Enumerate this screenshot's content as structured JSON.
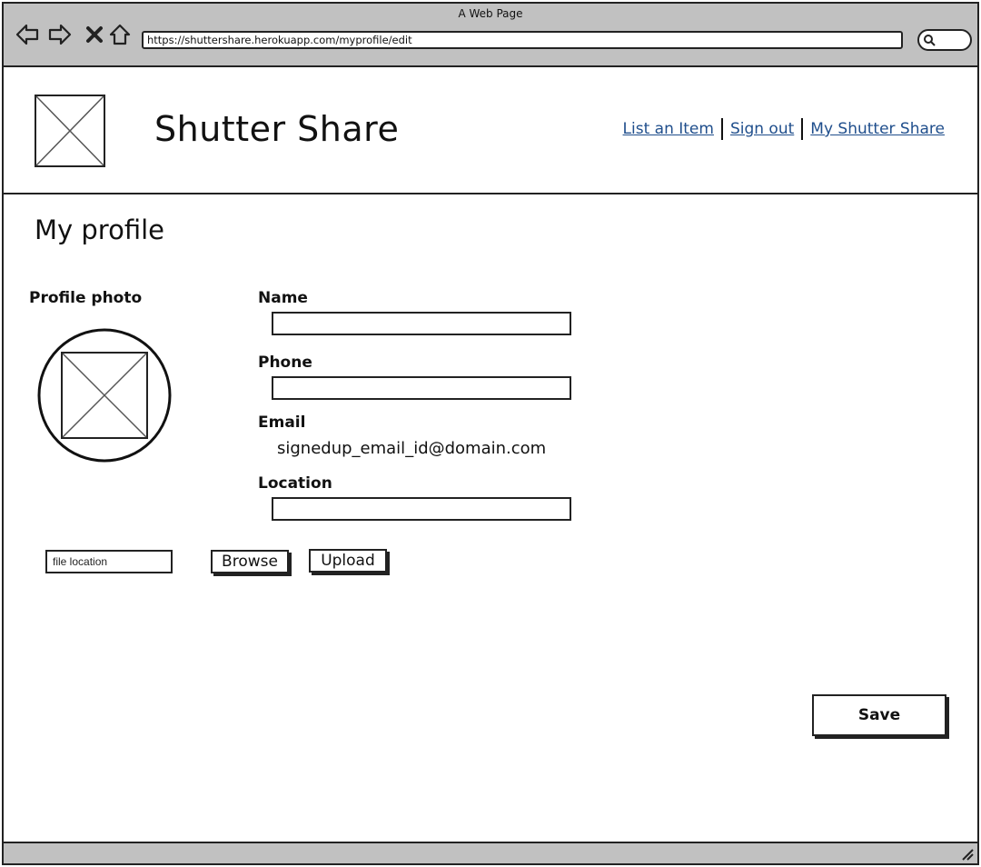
{
  "browser": {
    "window_title": "A Web Page",
    "url": "https://shuttershare.herokuapp.com/myprofile/edit",
    "icons": [
      "back-arrow-icon",
      "forward-arrow-icon",
      "close-icon",
      "home-icon",
      "search-icon"
    ]
  },
  "header": {
    "site_title": "Shutter Share",
    "links": {
      "list_item": "List an Item",
      "sign_out": "Sign out",
      "my_account": "My Shutter Share"
    }
  },
  "main": {
    "page_title": "My profile",
    "photo": {
      "label": "Profile photo",
      "file_placeholder": "file location",
      "browse_label": "Browse",
      "upload_label": "Upload"
    },
    "form": {
      "name_label": "Name",
      "name_value": "",
      "phone_label": "Phone",
      "phone_value": "",
      "email_label": "Email",
      "email_value": "signedup_email_id@domain.com",
      "location_label": "Location",
      "location_value": ""
    },
    "save_label": "Save"
  },
  "colors": {
    "chrome": "#c1c1c1",
    "link": "#1f4e8c",
    "border": "#222222"
  }
}
